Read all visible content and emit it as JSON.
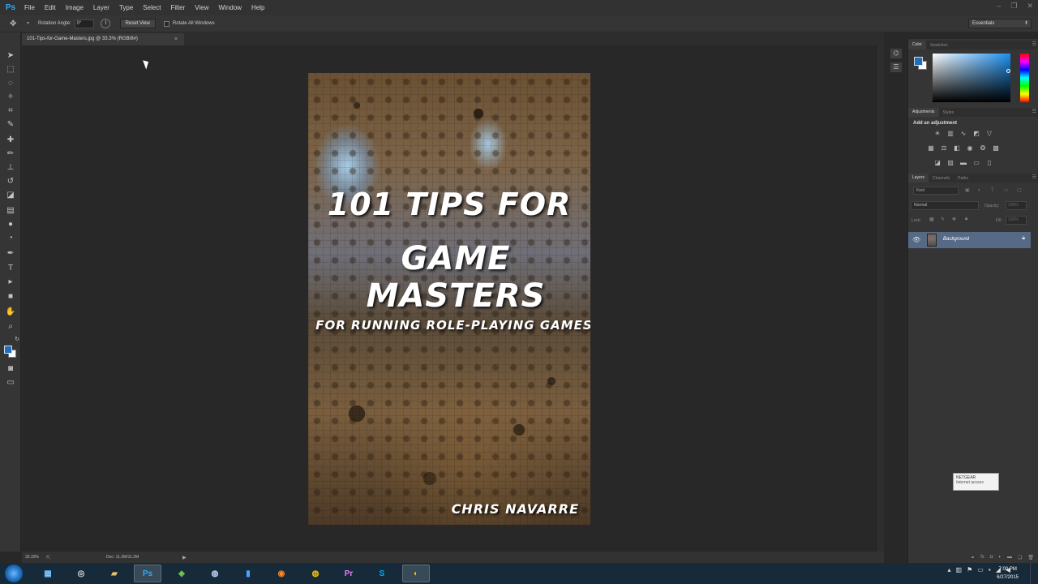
{
  "app": {
    "logo": "Ps",
    "menu": [
      "File",
      "Edit",
      "Image",
      "Layer",
      "Type",
      "Select",
      "Filter",
      "View",
      "Window",
      "Help"
    ]
  },
  "options_bar": {
    "rotation_label": "Rotation Angle:",
    "rotation_value": "0°",
    "reset_view": "Reset View",
    "rotate_all": "Rotate All Windows",
    "workspace": "Essentials"
  },
  "document": {
    "tab_title": "101-Tips-for-Game-Masters.jpg @ 33.3% (RGB/8#)",
    "zoom": "33.33%",
    "doc_info": "Doc: 11.2M/11.2M"
  },
  "cover": {
    "title_line1": "101 TIPS FOR",
    "title_line2": "GAME MASTERS",
    "subtitle": "FOR RUNNING ROLE-PLAYING GAMES",
    "author": "CHRIS NAVARRE"
  },
  "panels": {
    "color_tabs": [
      "Color",
      "Swatches"
    ],
    "adjust_tabs": [
      "Adjustments",
      "Styles"
    ],
    "adjust_title": "Add an adjustment",
    "layers_tabs": [
      "Layers",
      "Channels",
      "Paths"
    ],
    "kind_label": "Kind",
    "blend_mode": "Normal",
    "opacity_label": "Opacity:",
    "opacity_value": "100%",
    "lock_label": "Lock:",
    "fill_label": "Fill:",
    "fill_value": "100%",
    "layer_name": "Background"
  },
  "notification": {
    "network": "NETGEAR",
    "status": "Internet access"
  },
  "taskbar": {
    "time": "7:00 PM",
    "date": "6/27/2015"
  },
  "colors": {
    "foreground": "#1c6fbf",
    "background": "#ffffff",
    "selected_layer": "#566a86"
  }
}
